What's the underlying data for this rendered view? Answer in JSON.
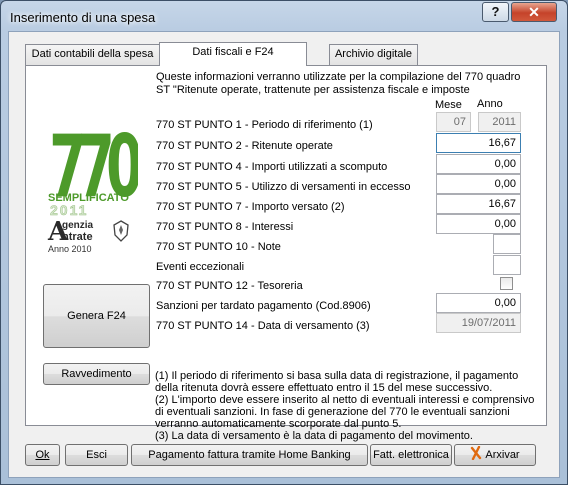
{
  "window": {
    "title": "Inserimento di una spesa",
    "help_label": "?",
    "close_label": "✕"
  },
  "tabs": [
    {
      "label": "Dati contabili della spesa",
      "active": false
    },
    {
      "label": "Dati fiscali e F24",
      "active": true
    },
    {
      "label": "Archivio digitale",
      "active": false
    }
  ],
  "logo": {
    "number": "770",
    "line1": "SEMPLIFICATO",
    "year": "2011",
    "agency": "genzia",
    "agency2": "ntrate",
    "anno": "Anno 2010",
    "colors": {
      "green": "#4d9a2a",
      "dark": "#2a2a2a"
    }
  },
  "intro": {
    "line1": "Queste informazioni verranno utilizzate per la compilazione del 770 quadro",
    "line2": "ST \"Ritenute operate, trattenute per assistenza fiscale e imposte"
  },
  "columns": {
    "mese": "Mese",
    "anno": "Anno"
  },
  "rows": {
    "p1": {
      "label": "770 ST PUNTO 1 - Periodo di riferimento (1)",
      "mese": "07",
      "anno": "2011"
    },
    "p2": {
      "label": "770 ST PUNTO 2 - Ritenute operate",
      "value": "16,67"
    },
    "p4": {
      "label": "770 ST PUNTO 4 - Importi utilizzati a scomputo",
      "value": "0,00"
    },
    "p5": {
      "label": "770 ST PUNTO 5 - Utilizzo di versamenti in eccesso",
      "value": "0,00"
    },
    "p7": {
      "label": "770 ST PUNTO 7 - Importo versato (2)",
      "value": "16,67"
    },
    "p8": {
      "label": "770 ST PUNTO 8 - Interessi",
      "value": "0,00"
    },
    "p10": {
      "label": "770 ST PUNTO 10 - Note",
      "value": ""
    },
    "eventi": {
      "label": "Eventi eccezionali",
      "value": ""
    },
    "p12": {
      "label": "770 ST PUNTO 12 - Tesoreria",
      "checked": false
    },
    "sanzioni": {
      "label": "Sanzioni per tardato pagamento (Cod.8906)",
      "value": "0,00"
    },
    "p14": {
      "label": "770 ST PUNTO 14 - Data di versamento (3)",
      "value": "19/07/2011"
    }
  },
  "buttons": {
    "genera_f24": "Genera F24",
    "ravvedimento": "Ravvedimento",
    "ok": "Ok",
    "esci": "Esci",
    "home_banking": "Pagamento fattura tramite Home Banking",
    "fatt_elettronica": "Fatt. elettronica",
    "archivia": "Arxivar"
  },
  "notes": [
    "(1) Il periodo di riferimento si basa sulla data di registrazione, il pagamento",
    "della ritenuta dovrà essere effettuato entro il 15 del mese successivo.",
    "(2) L'importo deve essere inserito al netto di eventuali interessi e comprensivo",
    "di eventuali sanzioni. In fase di generazione del 770 le eventuali sanzioni",
    "verranno automaticamente scorporate dal punto 5.",
    "(3) La data di versamento è la data di pagamento del movimento."
  ]
}
